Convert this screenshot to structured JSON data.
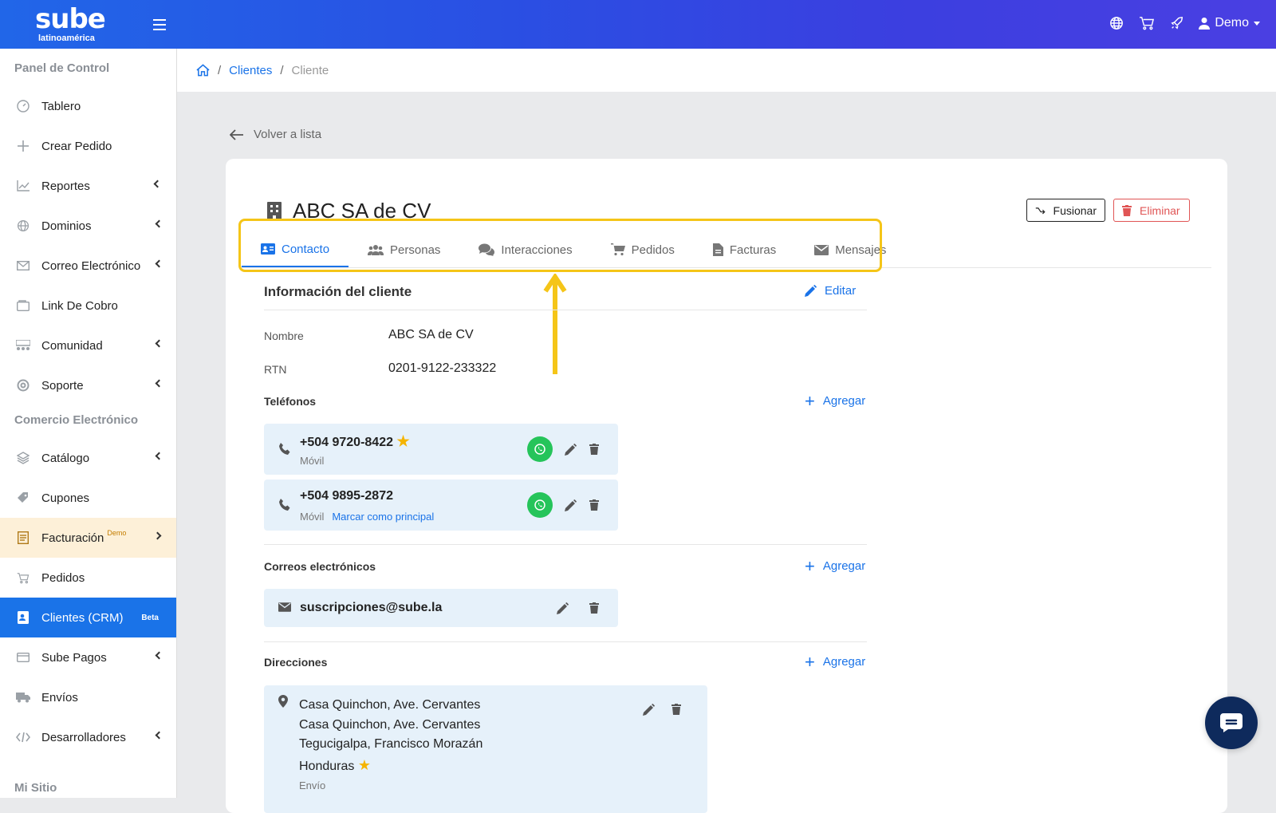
{
  "header": {
    "logo_text": "sube",
    "logo_sub": "latinoamérica",
    "user_label": "Demo",
    "icons": [
      "globe-icon",
      "cart-icon",
      "rocket-icon",
      "user-icon"
    ]
  },
  "sidebar": {
    "sections": [
      {
        "label": "Panel de Control"
      },
      {
        "label": "Comercio Electrónico"
      },
      {
        "label": "Mi Sitio"
      }
    ],
    "items": [
      {
        "label": "Tablero",
        "icon": "dashboard-icon"
      },
      {
        "label": "Crear Pedido",
        "icon": "plus-icon"
      },
      {
        "label": "Reportes",
        "icon": "chart-icon"
      },
      {
        "label": "Dominios",
        "icon": "globe-icon"
      },
      {
        "label": "Correo Electrónico",
        "icon": "mail-icon"
      },
      {
        "label": "Link De Cobro",
        "icon": "wallet-icon"
      },
      {
        "label": "Comunidad",
        "icon": "community-icon"
      },
      {
        "label": "Soporte",
        "icon": "lifebuoy-icon"
      },
      {
        "label": "Catálogo",
        "icon": "layers-icon"
      },
      {
        "label": "Cupones",
        "icon": "tag-icon"
      },
      {
        "label": "Facturación",
        "badge": "Demo",
        "icon": "invoice-icon"
      },
      {
        "label": "Pedidos",
        "icon": "cart-icon"
      },
      {
        "label": "Clientes (CRM)",
        "badge": "Beta",
        "icon": "contact-card-icon"
      },
      {
        "label": "Sube Pagos",
        "icon": "credit-card-icon"
      },
      {
        "label": "Envíos",
        "icon": "truck-icon"
      },
      {
        "label": "Desarrolladores",
        "icon": "code-icon"
      }
    ]
  },
  "breadcrumb": {
    "home_icon": "home-icon",
    "link": "Clientes",
    "current": "Cliente"
  },
  "back_label": "Volver a lista",
  "client": {
    "name": "ABC SA de CV",
    "merge_label": "Fusionar",
    "delete_label": "Eliminar"
  },
  "tabs": [
    {
      "label": "Contacto",
      "icon": "contact-card-icon"
    },
    {
      "label": "Personas",
      "icon": "users-icon"
    },
    {
      "label": "Interacciones",
      "icon": "comments-icon"
    },
    {
      "label": "Pedidos",
      "icon": "cart-icon"
    },
    {
      "label": "Facturas",
      "icon": "file-icon"
    },
    {
      "label": "Mensajes",
      "icon": "envelope-icon"
    }
  ],
  "info": {
    "title": "Información del cliente",
    "edit_label": "Editar",
    "name_label": "Nombre",
    "name_value": "ABC SA de CV",
    "rtn_label": "RTN",
    "rtn_value": "0201-9122-233322"
  },
  "phones": {
    "title": "Teléfonos",
    "add_label": "Agregar",
    "items": [
      {
        "number": "+504 9720-8422",
        "type": "Móvil",
        "primary": true
      },
      {
        "number": "+504 9895-2872",
        "type": "Móvil",
        "make_primary": "Marcar como principal"
      }
    ]
  },
  "emails": {
    "title": "Correos electrónicos",
    "add_label": "Agregar",
    "items": [
      {
        "address": "suscripciones@sube.la"
      }
    ]
  },
  "addresses": {
    "title": "Direcciones",
    "add_label": "Agregar",
    "items": [
      {
        "lines": [
          "Casa Quinchon, Ave. Cervantes",
          "Casa Quinchon, Ave. Cervantes",
          "Tegucigalpa, Francisco Morazán",
          "Honduras"
        ],
        "type": "Envío",
        "primary": true
      }
    ]
  },
  "colors": {
    "primary": "#1a73e8",
    "highlight": "#f5c518",
    "whatsapp": "#25c45a",
    "danger": "#e05555"
  }
}
